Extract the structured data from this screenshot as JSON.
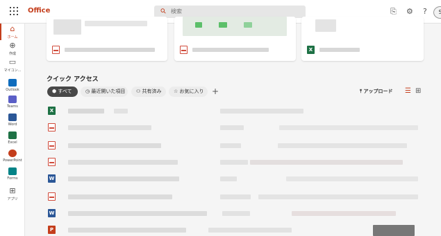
{
  "topbar": {
    "brand": "Office",
    "search_placeholder": "検索",
    "icons": [
      "waffle-icon",
      "notification-icon",
      "gear-icon",
      "help-icon"
    ],
    "help_label": "?",
    "avatar_initial": "S"
  },
  "nav": {
    "items": [
      {
        "name": "home",
        "label": "ホーム",
        "icon": "home-icon",
        "active": true
      },
      {
        "name": "create",
        "label": "作成",
        "icon": "plus-circle-icon"
      },
      {
        "name": "mycontent",
        "label": "マイコン...",
        "icon": "folder-icon"
      },
      {
        "name": "outlook",
        "label": "Outlook",
        "icon": "outlook-icon",
        "color": "#0f6cbd"
      },
      {
        "name": "teams",
        "label": "Teams",
        "icon": "teams-icon",
        "color": "#5b5fc7"
      },
      {
        "name": "word",
        "label": "Word",
        "icon": "word-icon",
        "color": "#2b5797"
      },
      {
        "name": "excel",
        "label": "Excel",
        "icon": "excel-icon",
        "color": "#1e7145"
      },
      {
        "name": "powerpoint",
        "label": "PowerPoint",
        "icon": "powerpoint-icon",
        "color": "#c43e1c"
      },
      {
        "name": "forms",
        "label": "Forms",
        "icon": "forms-icon",
        "color": "#038387"
      },
      {
        "name": "apps",
        "label": "アプリ",
        "icon": "apps-icon"
      }
    ]
  },
  "quick_access": {
    "title": "クイック アクセス",
    "filters": {
      "all": "すべて",
      "recent": "最近開いた項目",
      "shared": "共有済み",
      "favorites": "お気に入り"
    },
    "add_label": "+",
    "upload_label": "アップロード",
    "file_types": [
      "excel",
      "pdf",
      "pdf",
      "pdf",
      "pdf",
      "word",
      "pdf",
      "word",
      "powerpoint"
    ]
  },
  "colors": {
    "accent": "#c43e1c",
    "excel": "#1e7145",
    "word": "#2b5797",
    "pdf": "#d04a3a"
  }
}
